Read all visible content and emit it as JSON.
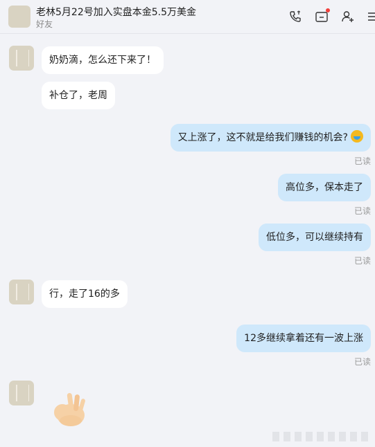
{
  "header": {
    "title": "老林5月22号加入实盘本金5.5万美金",
    "subtitle": "好友",
    "icons": [
      "phone-video-icon",
      "folder-icon",
      "add-friend-icon",
      "more-icon"
    ]
  },
  "messages": [
    {
      "side": "in",
      "text": "奶奶滴，怎么还下来了！"
    },
    {
      "side": "in",
      "text": "补仓了，老周"
    },
    {
      "side": "out",
      "text": "又上涨了，这不就是给我们赚钱的机会?",
      "emoji": "laughing-crying-emoji",
      "status": "已读"
    },
    {
      "side": "out",
      "text": "高位多，保本走了",
      "status": "已读"
    },
    {
      "side": "out",
      "text": "低位多，可以继续持有",
      "status": "已读"
    },
    {
      "side": "in",
      "text": "行，走了16的多"
    },
    {
      "side": "out",
      "text": "12多继续拿着还有一波上涨",
      "status": "已读"
    },
    {
      "side": "in",
      "sticker": "ok-hand-emoji"
    }
  ],
  "colors": {
    "background": "#f2f3f7",
    "incoming_bubble": "#ffffff",
    "outgoing_bubble": "#cfe8fb",
    "notification_dot": "#f1403c"
  }
}
